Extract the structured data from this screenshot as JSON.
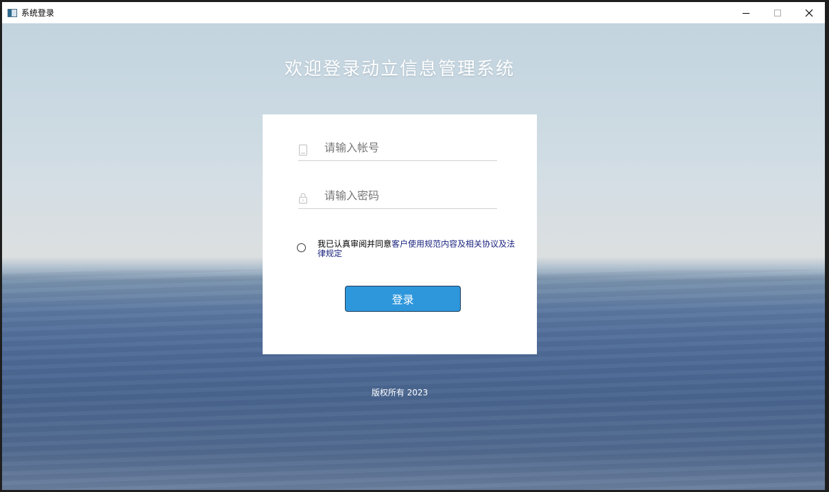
{
  "window": {
    "title": "系统登录",
    "controls": {
      "minimize": "minimize-icon",
      "maximize": "maximize-icon",
      "close": "close-icon"
    }
  },
  "login": {
    "welcome": "欢迎登录动立信息管理系统",
    "account_placeholder": "请输入帐号",
    "password_placeholder": "请输入密码",
    "agreement_prefix": "我已认真审阅并同意",
    "agreement_link": "客户使用规范内容及相关协议及法律规定",
    "agreement_checked": false,
    "login_button": "登录"
  },
  "footer": {
    "copyright": "版权所有 2023"
  },
  "colors": {
    "button_bg": "#2e97dc",
    "link": "#1a237e"
  }
}
